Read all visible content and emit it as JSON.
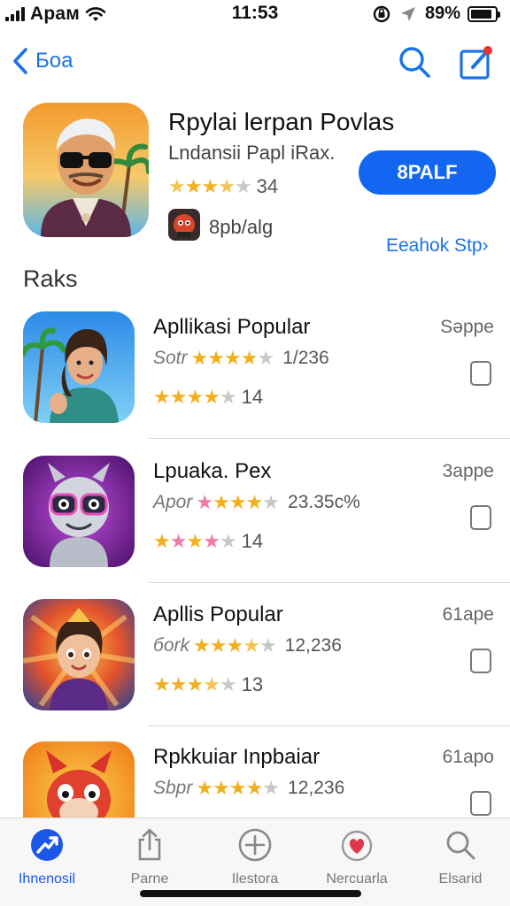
{
  "status": {
    "carrier": "Apaм",
    "time": "11:53",
    "battery": "89%",
    "battery_level": 0.89
  },
  "nav": {
    "back_label": "Бoa",
    "icons": [
      "chevron-left-icon",
      "search-icon",
      "compose-icon"
    ]
  },
  "featured": {
    "title": "Rpylai lerpan Povlas",
    "subtitle": "Lndansii Papl iRax.",
    "stars": [
      "half",
      "on",
      "on",
      "half",
      "off"
    ],
    "rating_count": "34",
    "get_label": "8PALF",
    "developer": "8pb/alg",
    "see_all": "Eeahok Stp›"
  },
  "section_title": "Raks",
  "apps": [
    {
      "title": "Apllikasi Popular",
      "subtitle": "Sotr",
      "sub_stars": [
        "on",
        "on",
        "on",
        "on",
        "off"
      ],
      "sub_count": "1/236",
      "rating_stars": [
        "on",
        "on",
        "on",
        "on",
        "off"
      ],
      "rating_count": "14",
      "price": "Səppe"
    },
    {
      "title": "Lpuaka. Pex",
      "subtitle": "Apor",
      "sub_stars": [
        "pink",
        "on",
        "on",
        "on",
        "off"
      ],
      "sub_count": "23.35c%",
      "rating_stars": [
        "on",
        "pink",
        "on",
        "pink",
        "off"
      ],
      "rating_count": "14",
      "price": "3appe"
    },
    {
      "title": "Apllis Popular",
      "subtitle": "бork",
      "sub_stars": [
        "on",
        "on",
        "on",
        "half",
        "off"
      ],
      "sub_count": "12,236",
      "rating_stars": [
        "on",
        "on",
        "on",
        "half",
        "off"
      ],
      "rating_count": "13",
      "price": "61ape"
    },
    {
      "title": "Rpkkuiar Inpbaiar",
      "subtitle": "Sbpr",
      "sub_stars": [
        "on",
        "on",
        "on",
        "on",
        "off"
      ],
      "sub_count": "12,236",
      "rating_stars": [
        "on",
        "on",
        "on",
        "on",
        "off"
      ],
      "rating_count": "",
      "price": "61apo"
    }
  ],
  "tabs": [
    {
      "label": "Ihnenosil",
      "icon": "today-icon",
      "active": true
    },
    {
      "label": "Parne",
      "icon": "share-icon",
      "active": false
    },
    {
      "label": "Ilestora",
      "icon": "add-circle-icon",
      "active": false
    },
    {
      "label": "Nercuarla",
      "icon": "heart-icon",
      "active": false
    },
    {
      "label": "Elsarid",
      "icon": "search-icon",
      "active": false
    }
  ],
  "colors": {
    "accent": "#1266f1",
    "link": "#1a73e8",
    "star": "#f2b01e",
    "star_off": "#c8c8c8",
    "star_pink": "#f07aa8"
  }
}
